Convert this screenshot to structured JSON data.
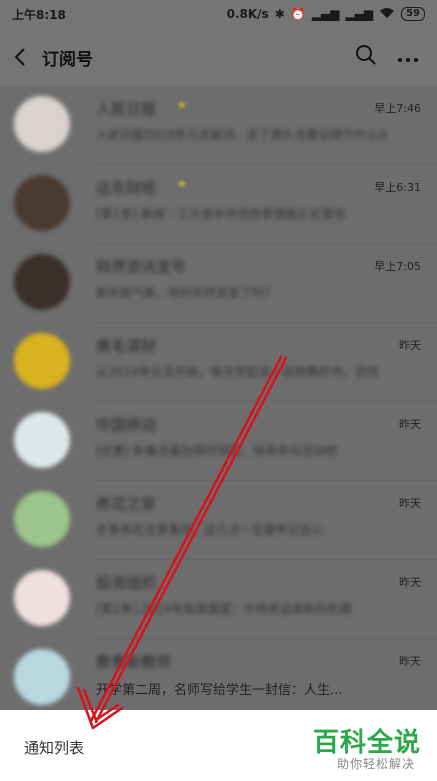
{
  "status": {
    "time": "上午8:18",
    "speed": "0.8K/s",
    "battery": "59"
  },
  "header": {
    "title": "订阅号"
  },
  "accounts": [
    {
      "name": "人民日报",
      "starred": true,
      "time": "早上7:46",
      "preview": "人民日报2019年元旦献词，走了再久也要记得为什么出发",
      "avatar_color": "#d9d2cf",
      "preview_sharp": false
    },
    {
      "name": "远东财经",
      "starred": true,
      "time": "早上6:31",
      "preview": "[第1条] 新闻｜三大资本市场改革措施正式落地",
      "avatar_color": "#4a3a30",
      "preview_sharp": false
    },
    {
      "name": "财界资讯宝号",
      "starred": false,
      "time": "早上7:05",
      "preview": "新年新气象，你的年终奖发了吗？",
      "avatar_color": "#3a2f2a",
      "preview_sharp": false
    },
    {
      "name": "黄毛读财",
      "starred": false,
      "time": "昨天",
      "preview": "从2019年元旦开始，每天早起读一段经典好书，坚持",
      "avatar_color": "#d8b21f",
      "preview_sharp": false
    },
    {
      "name": "中国移动",
      "starred": false,
      "time": "昨天",
      "preview": "[优惠] 新春流量包限时领取，快来参与活动吧",
      "avatar_color": "#dde8ea",
      "preview_sharp": false
    },
    {
      "name": "养花之家",
      "starred": false,
      "time": "昨天",
      "preview": "冬季养花注意事项，这几点一定要牢记在心",
      "avatar_color": "#9bc58a",
      "preview_sharp": false
    },
    {
      "name": "投资组织",
      "starred": false,
      "time": "昨天",
      "preview": "[第1条] 2019年投资展望：市场将迎来新的机遇",
      "avatar_color": "#efe0e0",
      "preview_sharp": false
    },
    {
      "name": "教育新教师",
      "starred": false,
      "time": "昨天",
      "preview": "开学第二周，名师写给学生一封信：人生...",
      "avatar_color": "#b8d8e0",
      "preview_sharp": true
    }
  ],
  "bottom": {
    "notice_label": "通知列表",
    "brand_title": "百科全说",
    "brand_sub": "助你轻松解决"
  },
  "colors": {
    "overlay_gray": "#6d6d6d",
    "brand_green": "#2ba84a",
    "arrow_red": "#d8121a"
  }
}
